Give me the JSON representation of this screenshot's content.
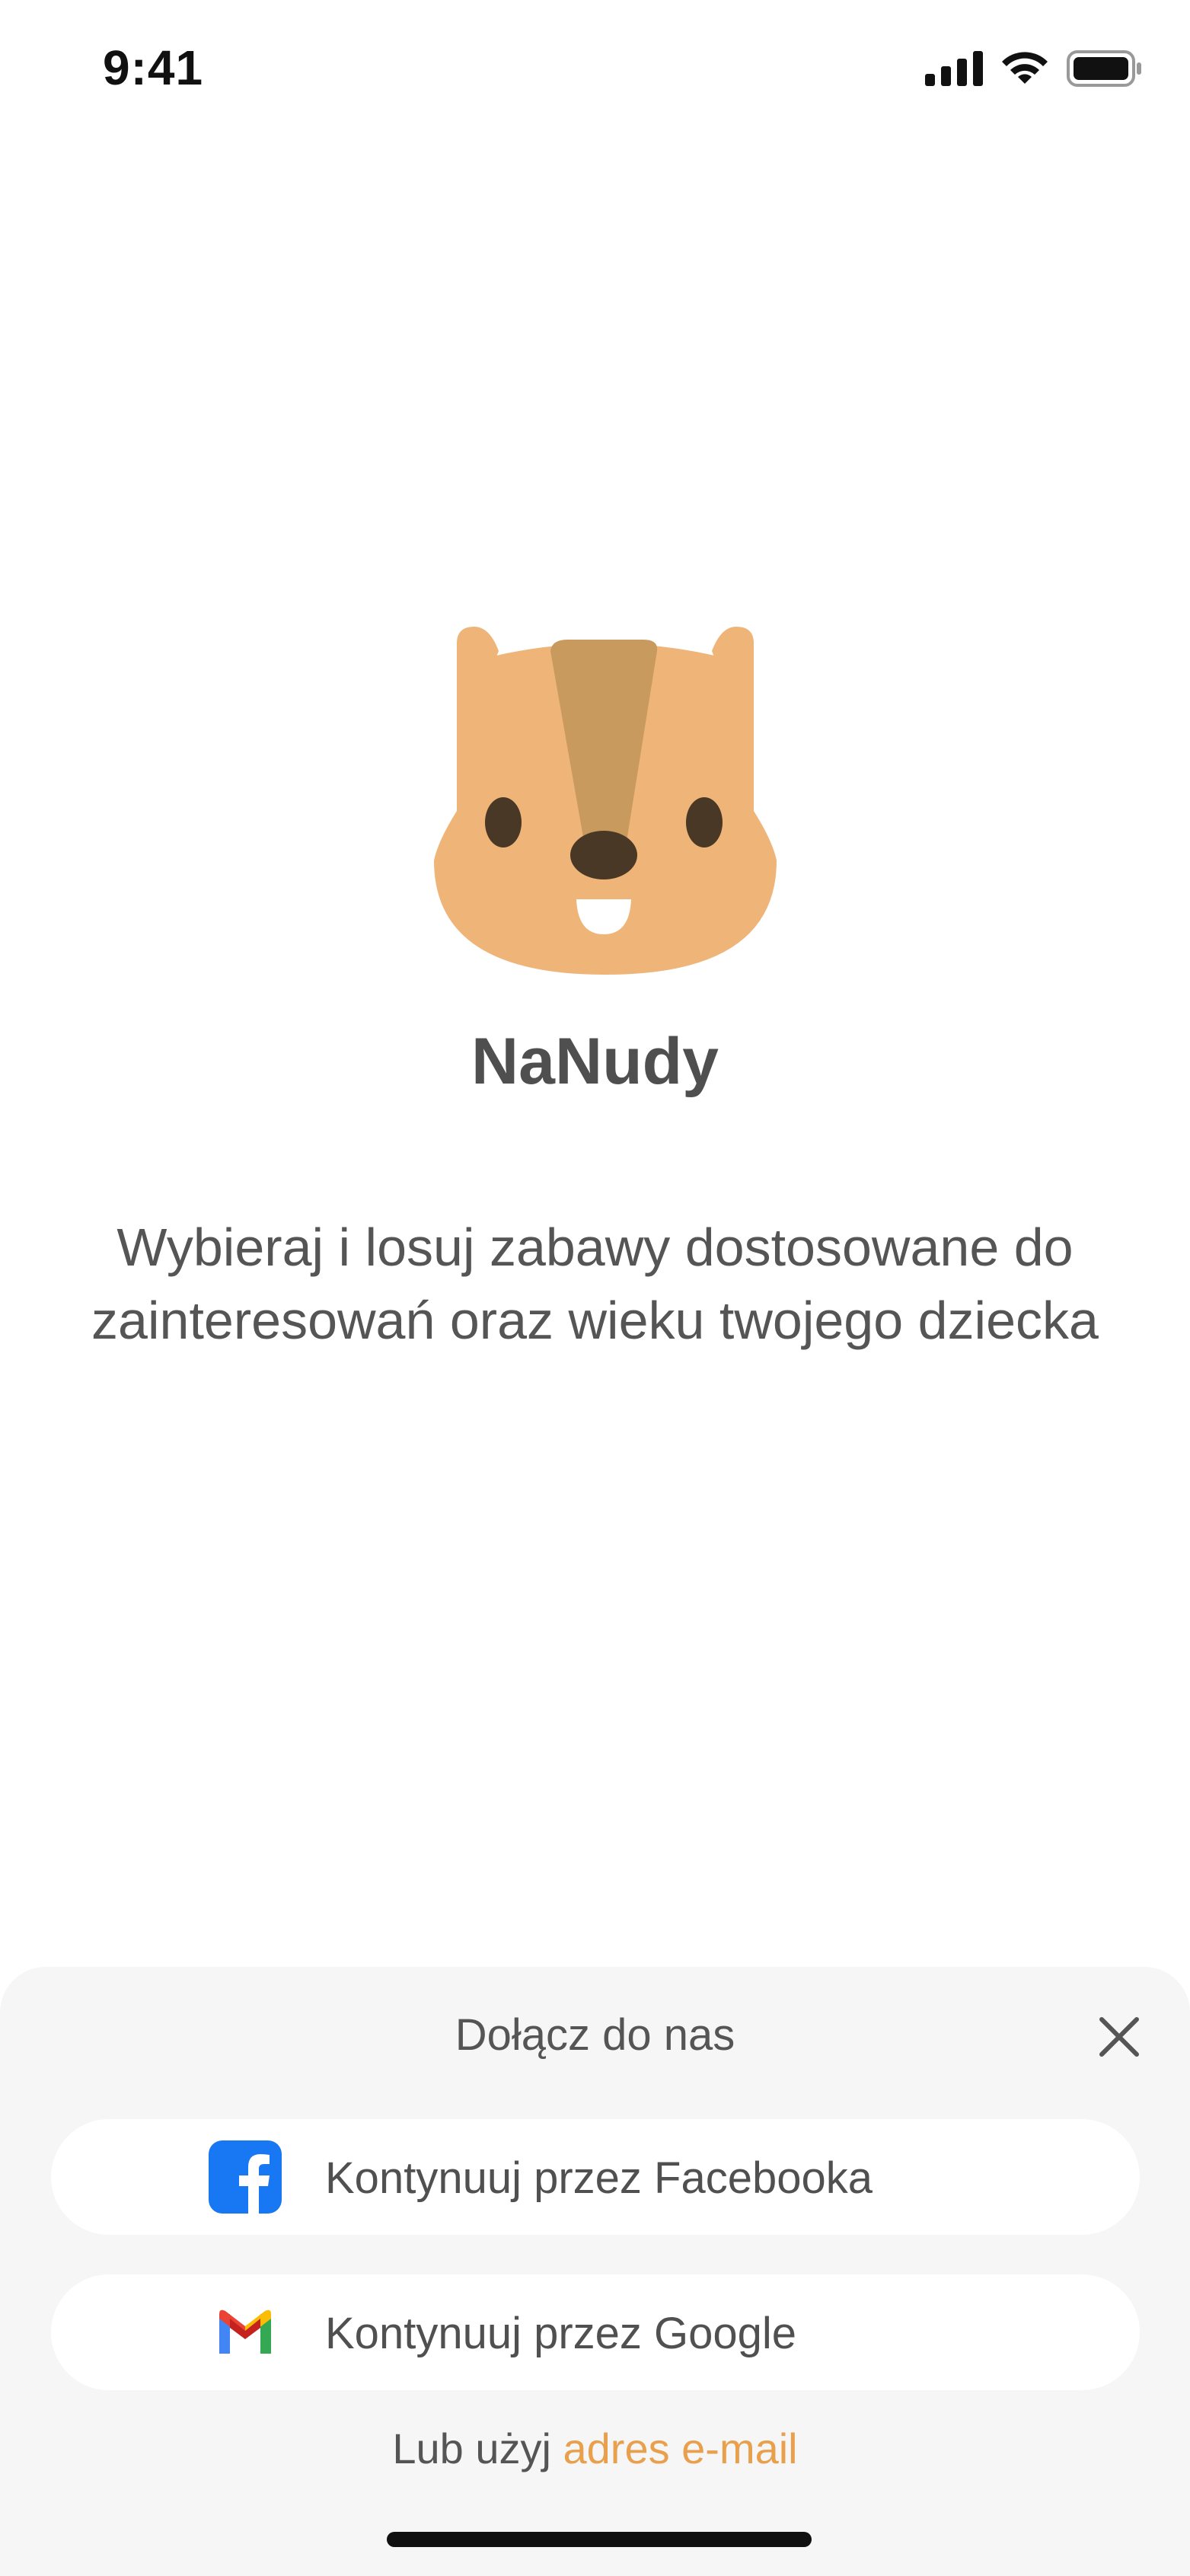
{
  "status_bar": {
    "time": "9:41"
  },
  "app": {
    "name": "NaNudy",
    "tagline_line1": "Wybieraj i losuj zabawy dostosowane do",
    "tagline_line2": "zainteresowań oraz wieku twojego dziecka"
  },
  "sheet": {
    "title": "Dołącz do nas",
    "facebook_label": "Kontynuuj przez Facebooka",
    "google_label": "Kontynuuj przez Google",
    "email_prefix": "Lub użyj ",
    "email_link": "adres e-mail"
  },
  "icons": {
    "close": "close-icon",
    "facebook": "facebook-icon",
    "gmail": "gmail-icon",
    "logo": "chipmunk-logo"
  },
  "colors": {
    "accent": "#e8a04c",
    "logo_fur": "#efb478",
    "logo_stripe": "#c89a5e",
    "logo_features": "#4a3826",
    "facebook_blue": "#1877f2",
    "sheet_bg": "#f6f6f6"
  }
}
